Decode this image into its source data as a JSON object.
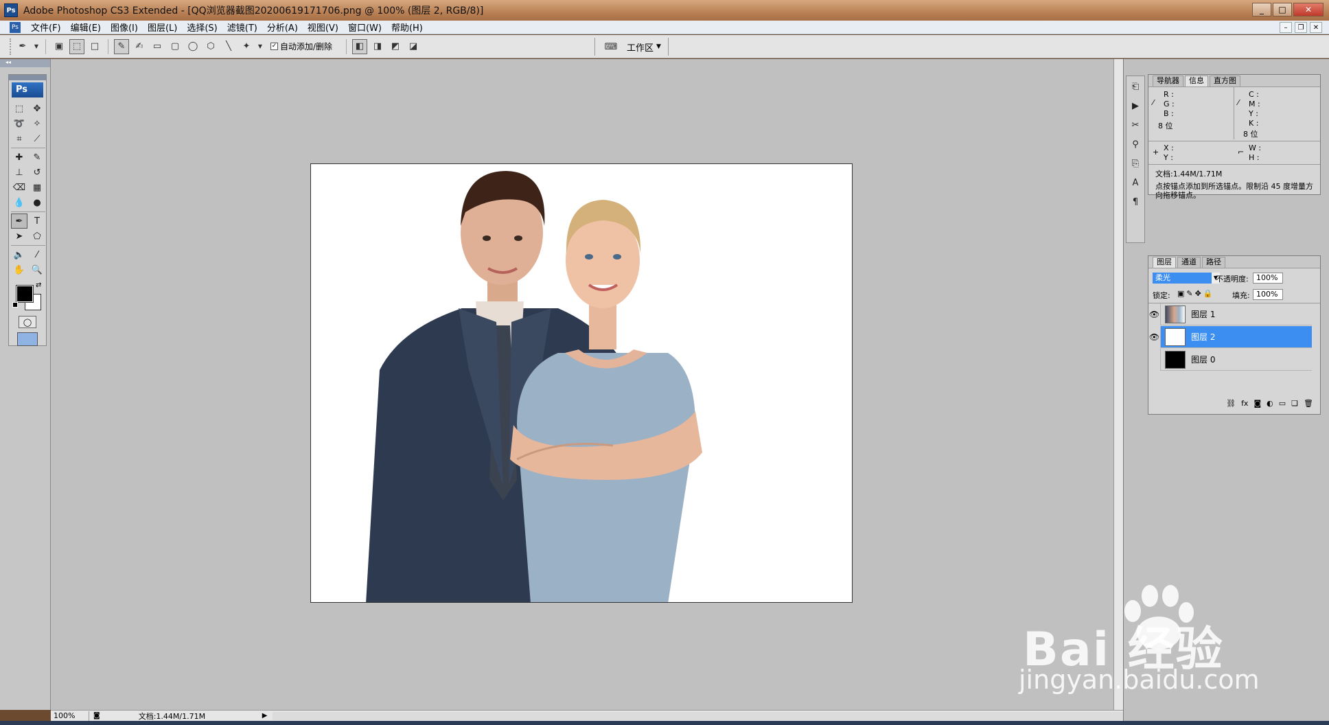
{
  "window": {
    "title": "Adobe Photoshop CS3 Extended - [QQ浏览器截图20200619171706.png @ 100% (图层 2, RGB/8)]",
    "app_badge": "Ps",
    "minimize": "_",
    "maximize": "□",
    "close": "✕"
  },
  "menu": {
    "items": [
      "文件(F)",
      "编辑(E)",
      "图像(I)",
      "图层(L)",
      "选择(S)",
      "滤镜(T)",
      "分析(A)",
      "视图(V)",
      "窗口(W)",
      "帮助(H)"
    ]
  },
  "options": {
    "auto_add_delete": "自动添加/删除",
    "auto_add_delete_checked": true,
    "workspace": "工作区"
  },
  "tools": {
    "logo": "Ps"
  },
  "status": {
    "zoom": "100%",
    "doc": "文档:1.44M/1.71M"
  },
  "info_panel": {
    "tabs": [
      "导航器",
      "信息",
      "直方图"
    ],
    "active_tab": "信息",
    "r": "R :",
    "g": "G :",
    "b": "B :",
    "c": "C :",
    "m": "M :",
    "y": "Y :",
    "k": "K :",
    "bits_left": "8 位",
    "bits_right": "8 位",
    "x": "X :",
    "ylabel": "Y :",
    "w": "W :",
    "h": "H :",
    "doc": "文档:1.44M/1.71M",
    "hint": "点按锚点添加到所选锚点。限制沿 45 度增量方向拖移锚点。"
  },
  "layers_panel": {
    "tabs": [
      "图层",
      "通道",
      "路径"
    ],
    "active_tab": "图层",
    "blend_mode": "柔光",
    "opacity_label": "不透明度:",
    "opacity": "100%",
    "lock_label": "锁定:",
    "fill_label": "填充:",
    "fill": "100%",
    "layers": [
      {
        "name": "图层 1",
        "visible": true,
        "selected": false,
        "thumb": "photo"
      },
      {
        "name": "图层 2",
        "visible": true,
        "selected": true,
        "thumb": "white"
      },
      {
        "name": "图层 0",
        "visible": false,
        "selected": false,
        "thumb": "black"
      }
    ]
  },
  "watermark": {
    "brand": "Bai 经验",
    "url": "jingyan.baidu.com"
  }
}
